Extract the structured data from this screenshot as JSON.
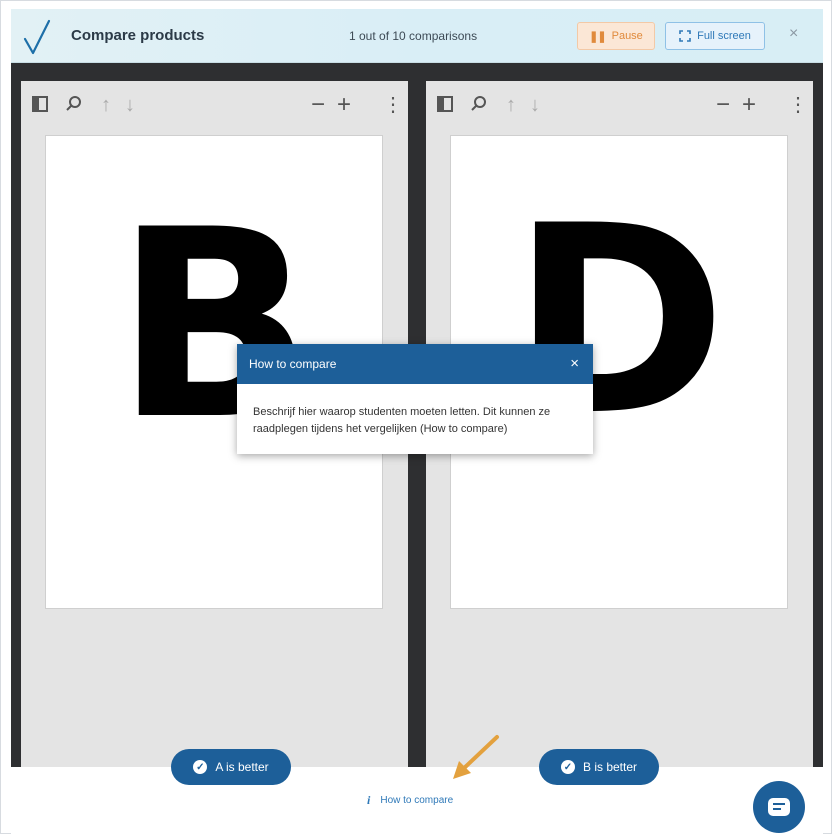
{
  "header": {
    "title": "Compare products",
    "counter": "1 out of 10 comparisons",
    "pause_label": "Pause",
    "fullscreen_label": "Full screen",
    "close_symbol": "×"
  },
  "viewers": {
    "left": {
      "letter": "B"
    },
    "right": {
      "letter": "D"
    }
  },
  "toolbar_icons": [
    "sidebar-toggle-icon",
    "search-icon",
    "arrow-up-icon",
    "arrow-down-icon",
    "minus-icon",
    "plus-icon",
    "kebab-menu-icon"
  ],
  "buttons": {
    "a_better": "A is better",
    "b_better": "B is better"
  },
  "howto_link": "How to compare",
  "dialog": {
    "title": "How to compare",
    "close_symbol": "×",
    "body": "Beschrijf hier waarop studenten moeten letten. Dit kunnen ze raadplegen tijdens het vergelijken (How to compare)"
  },
  "colors": {
    "primary": "#1d5f99",
    "pause_text": "#e08a3c",
    "stage_bg": "#2e2f31",
    "arrow": "#e3a13e"
  }
}
